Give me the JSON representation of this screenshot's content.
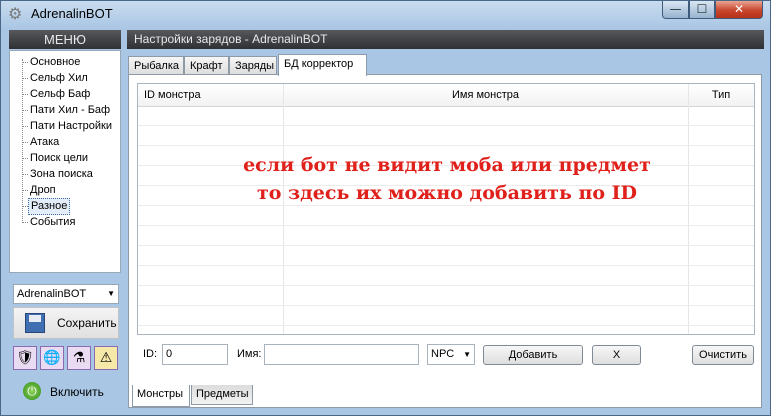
{
  "window": {
    "title": "AdrenalinBOT",
    "controls": {
      "minimize": "—",
      "maximize": "☐",
      "close": "✕"
    }
  },
  "sidebar": {
    "header": "МЕНЮ",
    "items": [
      {
        "label": "Основное"
      },
      {
        "label": "Сельф Хил"
      },
      {
        "label": "Сельф Баф"
      },
      {
        "label": "Пати Хил - Баф"
      },
      {
        "label": "Пати Настройки"
      },
      {
        "label": "Атака"
      },
      {
        "label": "Поиск цели"
      },
      {
        "label": "Зона поиска"
      },
      {
        "label": "Дроп"
      },
      {
        "label": "Разное",
        "selected": true
      },
      {
        "label": "События"
      }
    ],
    "profile_select": {
      "value": "AdrenalinBOT"
    },
    "save_label": "Сохранить",
    "enable_label": "Включить",
    "icons": [
      "shield-icon",
      "globe-icon",
      "potion-icon",
      "warning-icon"
    ]
  },
  "section": {
    "title": "Настройки зарядов  -  AdrenalinBOT",
    "tabs": [
      {
        "label": "Рыбалка"
      },
      {
        "label": "Крафт"
      },
      {
        "label": "Заряды"
      },
      {
        "label": "БД корректор",
        "active": true
      }
    ],
    "grid": {
      "columns": [
        "ID монстра",
        "Имя монстра",
        "Тип"
      ],
      "rows": []
    },
    "annotation": [
      "если бот не видит моба или предмет",
      "то здесь их можно добавить по ID"
    ],
    "form": {
      "id_label": "ID:",
      "id_value": "0",
      "name_label": "Имя:",
      "name_value": "",
      "type_value": "NPC",
      "add_label": "Добавить",
      "delete_label": "X",
      "clear_label": "Очистить"
    },
    "bottom_tabs": [
      {
        "label": "Монстры",
        "active": true
      },
      {
        "label": "Предметы"
      }
    ]
  },
  "colors": {
    "annotation_text": "#e0201a",
    "header_bg": "#3a3c40",
    "window_frame": "#a9c6e4"
  }
}
